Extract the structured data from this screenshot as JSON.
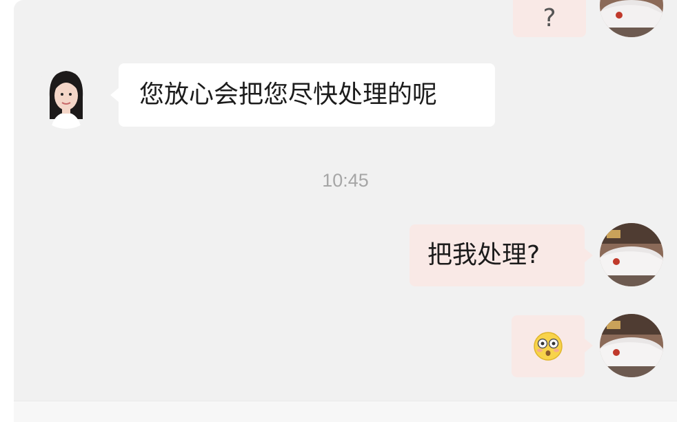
{
  "chat": {
    "messages": [
      {
        "sender": "other",
        "text": "您放心会把您尽快处理的呢"
      },
      {
        "sender": "me",
        "text": "把我处理?"
      },
      {
        "sender": "me",
        "emoji": "flushed-face"
      }
    ],
    "partial_top_message": "?",
    "timestamp": "10:45"
  },
  "avatars": {
    "agent": "woman-portrait-avatar",
    "user": "white-car-avatar"
  },
  "colors": {
    "background": "#f1f1f1",
    "incoming_bubble": "#ffffff",
    "outgoing_bubble": "#f9e9e6",
    "timestamp_text": "#a6a6a6"
  }
}
